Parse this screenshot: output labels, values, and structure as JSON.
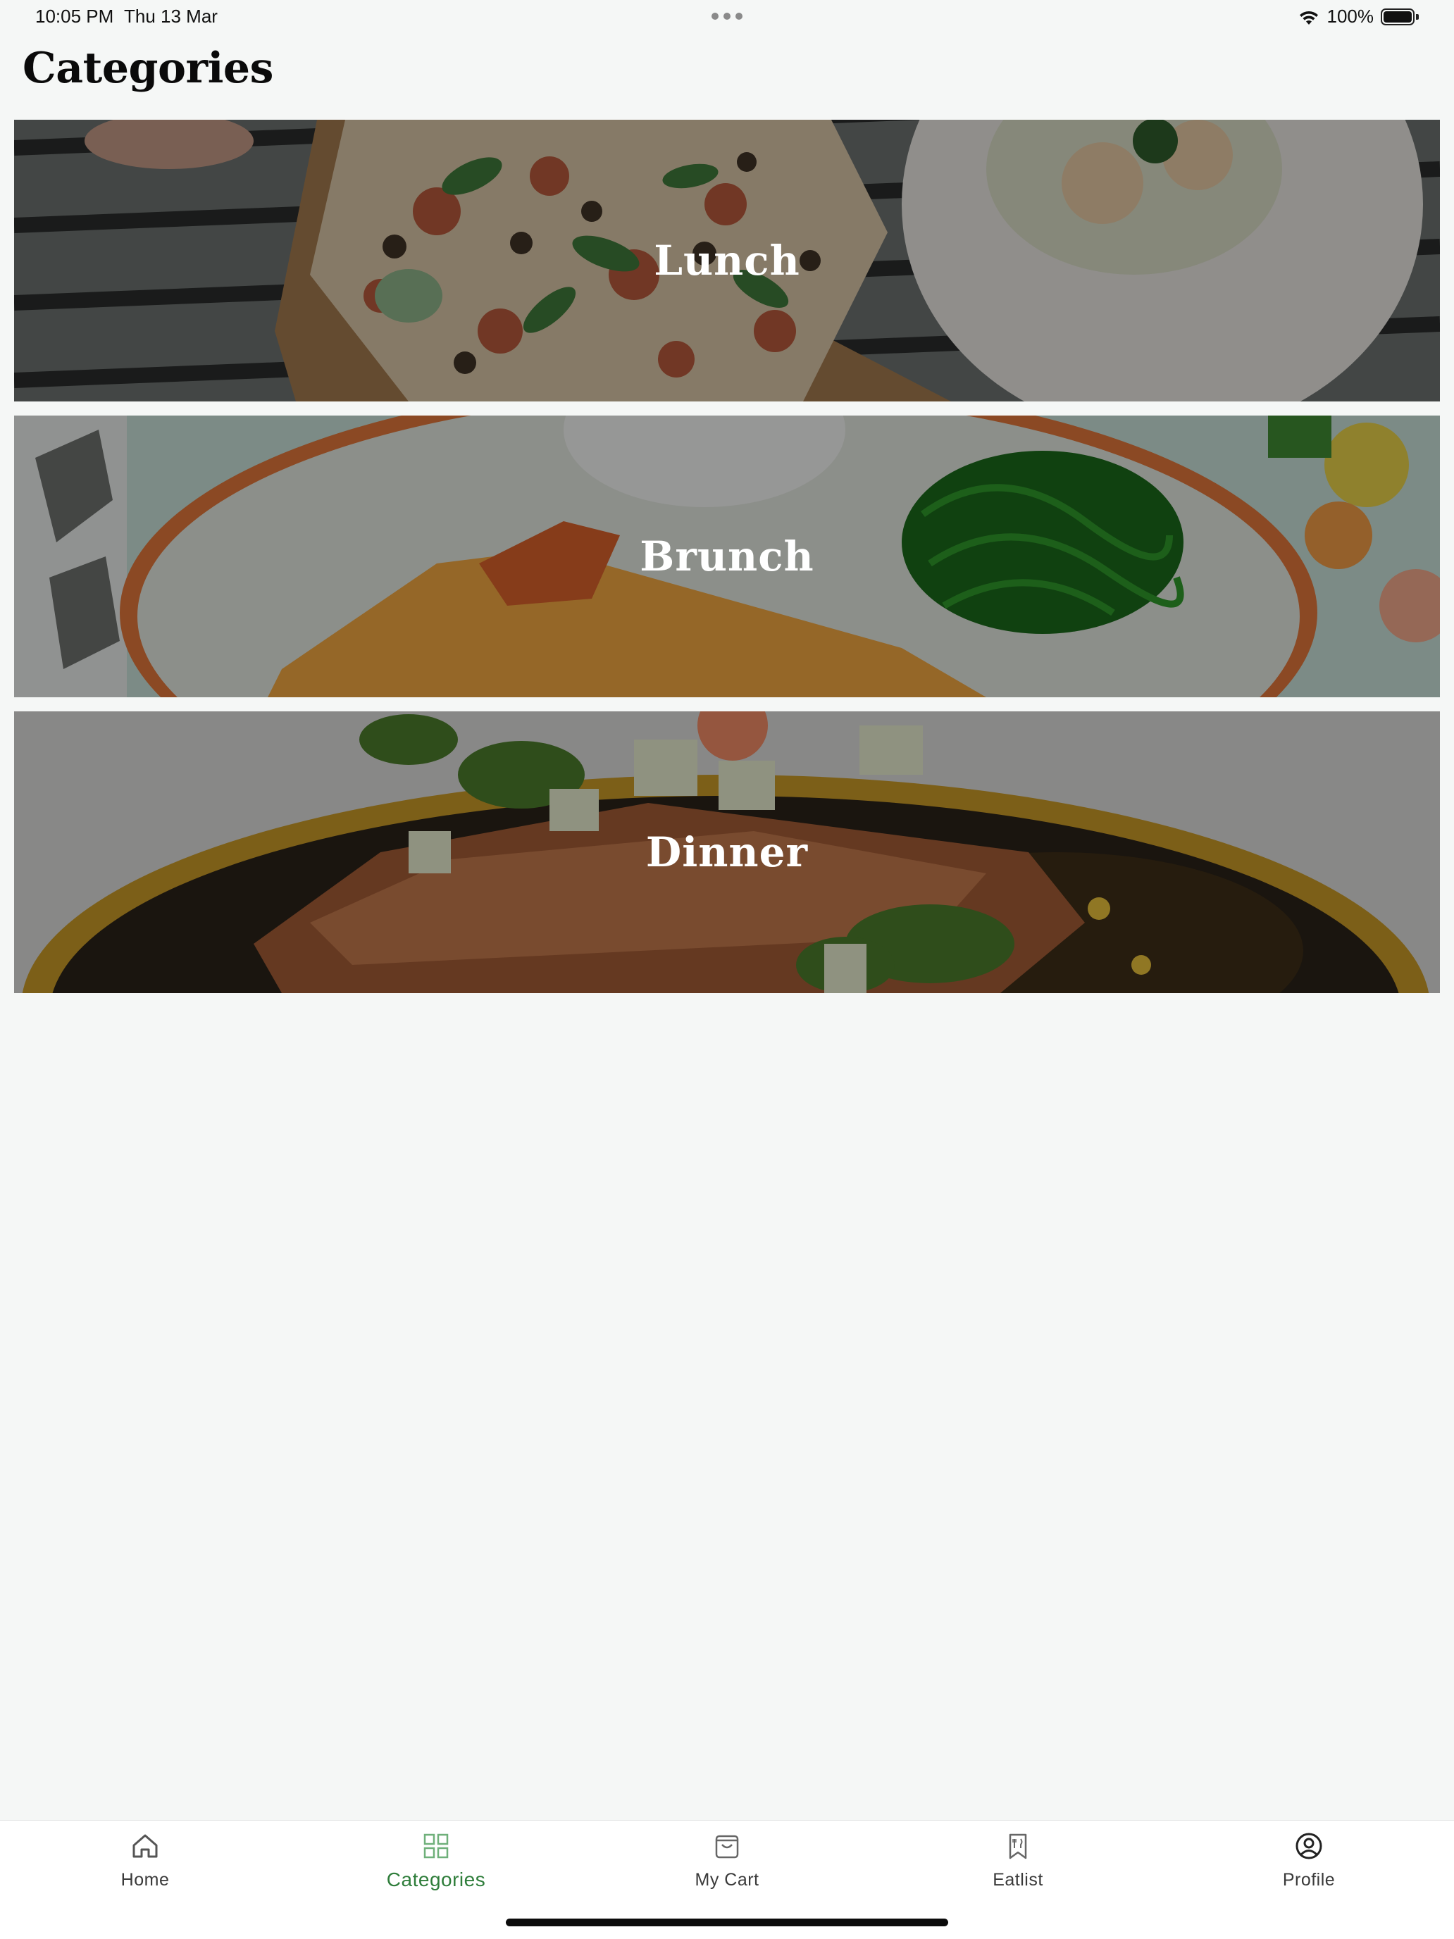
{
  "status_bar": {
    "time": "10:05 PM",
    "date": "Thu 13 Mar",
    "battery_percent": "100%",
    "battery_level": 1.0
  },
  "page": {
    "title": "Categories"
  },
  "categories": [
    {
      "label": "Lunch",
      "photo": "pizza-and-plate-photo"
    },
    {
      "label": "Brunch",
      "photo": "omelette-and-seaweed-photo"
    },
    {
      "label": "Dinner",
      "photo": "salmon-dish-photo"
    }
  ],
  "tab_bar": {
    "active": "Categories",
    "accent_color": "#2e7d3a",
    "tabs": [
      {
        "label": "Home",
        "icon": "house-icon"
      },
      {
        "label": "Categories",
        "icon": "grid-icon"
      },
      {
        "label": "My Cart",
        "icon": "shopping-bag-icon"
      },
      {
        "label": "Eatlist",
        "icon": "bookmark-utensils-icon"
      },
      {
        "label": "Profile",
        "icon": "user-circle-icon"
      }
    ]
  }
}
